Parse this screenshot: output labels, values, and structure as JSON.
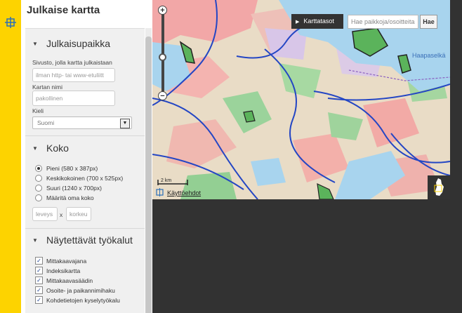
{
  "panel": {
    "title": "Julkaise kartta",
    "close_symbol": "×",
    "sections": {
      "location": {
        "title": "Julkaisupaikka",
        "site_label": "Sivusto, jolla kartta julkaistaan",
        "site_placeholder": "ilman http- tai www-etuliitt",
        "map_name_label": "Kartan nimi",
        "map_name_placeholder": "pakollinen",
        "language_label": "Kieli",
        "language_value": "Suomi"
      },
      "size": {
        "title": "Koko",
        "options": [
          {
            "label": "Pieni (580 x 387px)",
            "selected": true
          },
          {
            "label": "Keskikokoinen (700 x 525px)",
            "selected": false
          },
          {
            "label": "Suuri (1240 x 700px)",
            "selected": false
          },
          {
            "label": "Määritä oma koko",
            "selected": false
          }
        ],
        "width_placeholder": "leveys",
        "by_symbol": "x",
        "height_placeholder": "korkeu"
      },
      "tools": {
        "title": "Näytettävät työkalut",
        "items": [
          {
            "label": "Mittakaavajana",
            "checked": true
          },
          {
            "label": "Indeksikartta",
            "checked": true
          },
          {
            "label": "Mittakaavasäädin",
            "checked": true
          },
          {
            "label": "Osoite- ja paikannimihaku",
            "checked": true
          },
          {
            "label": "Kohdetietojen kyselytyökalu",
            "checked": true
          }
        ]
      }
    },
    "info_symbol": "i"
  },
  "map": {
    "layers_button": "Karttatasot",
    "search_placeholder": "Hae paikkoja/osoitteita",
    "search_button": "Hae",
    "place_label": "Haapaselkä",
    "scale_label": "2 km",
    "terms_link": "Käyttöehdot",
    "zoom_in": "+",
    "zoom_out": "−"
  },
  "colors": {
    "accent_yellow": "#fdd300",
    "background": "#323232",
    "water": "#a8d4ee",
    "info_blue": "#2b75c8"
  }
}
